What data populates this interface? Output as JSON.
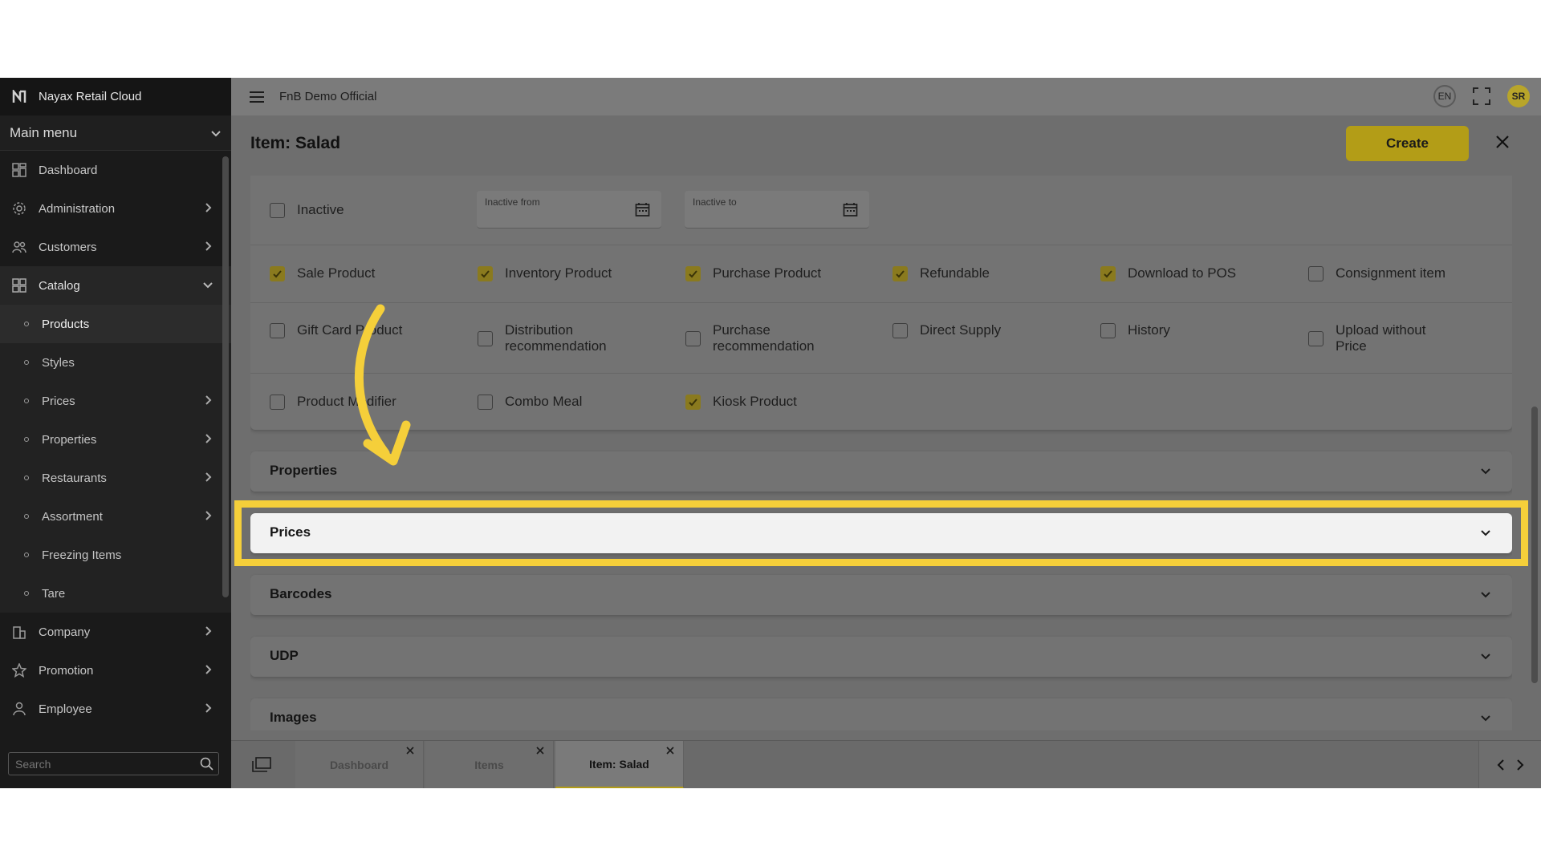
{
  "app": {
    "name": "Nayax Retail Cloud",
    "org": "FnB Demo Official"
  },
  "sidebar": {
    "menu_title": "Main menu",
    "items": [
      {
        "label": "Dashboard"
      },
      {
        "label": "Administration"
      },
      {
        "label": "Customers"
      },
      {
        "label": "Catalog"
      }
    ],
    "catalog_sub": [
      {
        "label": "Products"
      },
      {
        "label": "Styles"
      },
      {
        "label": "Prices"
      },
      {
        "label": "Properties"
      },
      {
        "label": "Restaurants"
      },
      {
        "label": "Assortment"
      },
      {
        "label": "Freezing Items"
      },
      {
        "label": "Tare"
      }
    ],
    "items_after": [
      {
        "label": "Company"
      },
      {
        "label": "Promotion"
      },
      {
        "label": "Employee"
      }
    ],
    "search_placeholder": "Search"
  },
  "topbar": {
    "lang": "EN",
    "avatar": "SR"
  },
  "page": {
    "title": "Item: Salad",
    "create_label": "Create"
  },
  "form": {
    "inactive_label": "Inactive",
    "inactive_from": "Inactive from",
    "inactive_to": "Inactive to",
    "flags_row1": [
      {
        "label": "Sale Product",
        "checked": true
      },
      {
        "label": "Inventory Product",
        "checked": true
      },
      {
        "label": "Purchase Product",
        "checked": true
      },
      {
        "label": "Refundable",
        "checked": true
      },
      {
        "label": "Download to POS",
        "checked": true
      },
      {
        "label": "Consignment item",
        "checked": false
      }
    ],
    "flags_row2": [
      {
        "label": "Gift Card Product",
        "checked": false
      },
      {
        "label": "Distribution recommendation",
        "checked": false
      },
      {
        "label": "Purchase recommendation",
        "checked": false
      },
      {
        "label": "Direct Supply",
        "checked": false
      },
      {
        "label": "History",
        "checked": false
      },
      {
        "label": "Upload without Price",
        "checked": false
      }
    ],
    "flags_row3": [
      {
        "label": "Product Modifier",
        "checked": false
      },
      {
        "label": "Combo Meal",
        "checked": false
      },
      {
        "label": "Kiosk Product",
        "checked": true
      }
    ]
  },
  "sections": [
    {
      "label": "Properties"
    },
    {
      "label": "Prices"
    },
    {
      "label": "Barcodes"
    },
    {
      "label": "UDP"
    },
    {
      "label": "Images"
    }
  ],
  "tabs": [
    {
      "label": "Dashboard"
    },
    {
      "label": "Items"
    },
    {
      "label": "Item: Salad"
    }
  ],
  "colors": {
    "accent": "#b39d17",
    "highlight": "#f5cf3a",
    "sidebar": "#1a1a1a"
  }
}
